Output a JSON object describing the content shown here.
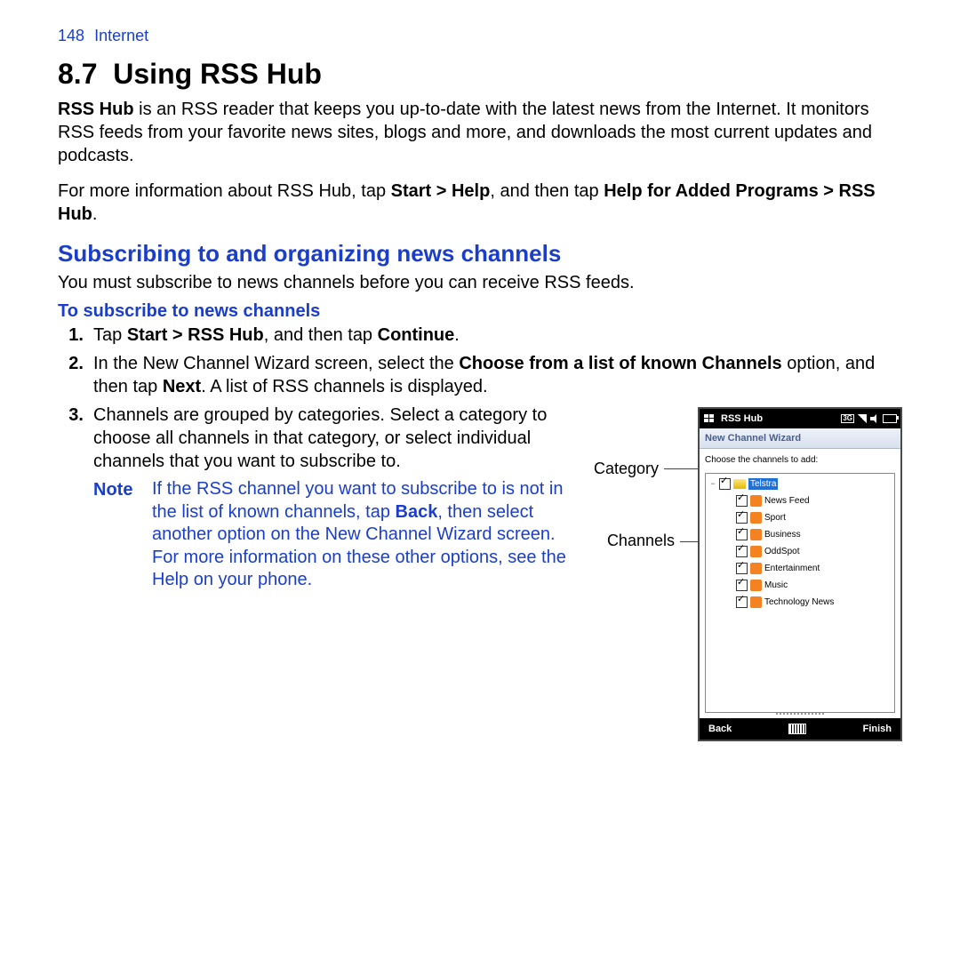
{
  "header": {
    "page_num": "148",
    "chapter": "Internet"
  },
  "section": {
    "number": "8.7",
    "title": "Using RSS Hub"
  },
  "intro": {
    "p1_lead": "RSS Hub",
    "p1_rest": " is an RSS reader that keeps you up-to-date with the latest news from the Internet. It monitors RSS feeds from your favorite news sites, blogs and more, and downloads the most current updates and podcasts.",
    "p2_a": "For more information about RSS Hub, tap ",
    "p2_b1": "Start > Help",
    "p2_c": ", and then tap ",
    "p2_b2": "Help for Added Programs > RSS Hub",
    "p2_d": "."
  },
  "subsection": "Subscribing to and organizing news channels",
  "sub_intro": "You must subscribe to news channels before you can receive RSS feeds.",
  "procedure_title": "To subscribe to news channels",
  "steps": {
    "s1_a": "Tap ",
    "s1_b1": "Start > RSS Hub",
    "s1_c": ", and then tap ",
    "s1_b2": "Continue",
    "s1_d": ".",
    "s2_a": "In the New Channel Wizard screen, select the ",
    "s2_b1": "Choose from a list of known Channels",
    "s2_c": " option, and then tap ",
    "s2_b2": "Next",
    "s2_d": ". A list of RSS channels is displayed.",
    "s3": "Channels are grouped by categories. Select a category to choose all channels in that category, or select individual channels that you want to subscribe to."
  },
  "note": {
    "label": "Note",
    "body_a": "If the RSS channel you want to subscribe to is not in the list of known channels, tap ",
    "body_b": "Back",
    "body_c": ", then select another option on the New Channel Wizard screen.",
    "body_d": "For more information on these other options, see the Help on your phone."
  },
  "callouts": {
    "category": "Category",
    "channels": "Channels"
  },
  "device": {
    "title": "RSS Hub",
    "subtitle": "New Channel Wizard",
    "prompt": "Choose the channels to add:",
    "category_label": "Telstra",
    "channels": [
      "News Feed",
      "Sport",
      "Business",
      "OddSpot",
      "Entertainment",
      "Music",
      "Technology News"
    ],
    "back": "Back",
    "finish": "Finish",
    "status_3g_a": "3G"
  }
}
